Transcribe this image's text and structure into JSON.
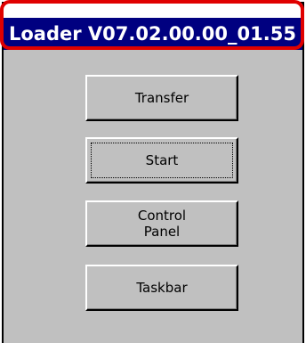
{
  "window": {
    "title": "Loader V07.02.00.00_01.55"
  },
  "buttons": {
    "transfer": "Transfer",
    "start": "Start",
    "control_panel": "Control\nPanel",
    "taskbar": "Taskbar"
  },
  "colors": {
    "titlebar_bg": "#000080",
    "window_bg": "#c0c0c0",
    "highlight": "#e00000"
  }
}
